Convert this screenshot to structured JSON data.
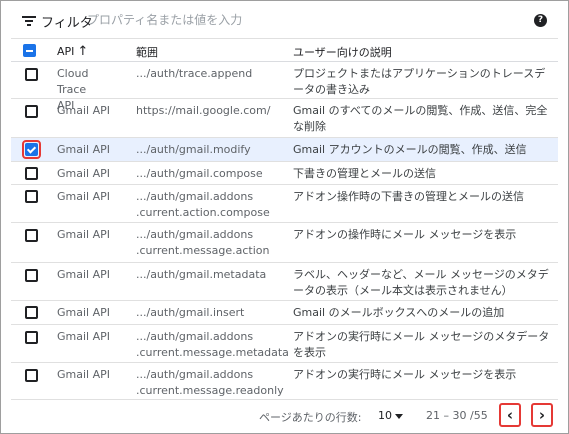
{
  "filter": {
    "label": "フィルタ",
    "placeholder": "プロパティ名または値を入力"
  },
  "help_icon": "?",
  "table": {
    "headers": {
      "api": "API",
      "scope": "範囲",
      "description": "ユーザー向けの説明"
    },
    "rows": [
      {
        "api": "Cloud Trace API",
        "scope": ".../auth/trace.append",
        "description": "プロジェクトまたはアプリケーションのトレースデータの書き込み",
        "checked": false
      },
      {
        "api": "Gmail API",
        "scope": "https://mail.google.com/",
        "description": "Gmail のすべてのメールの閲覧、作成、送信、完全な削除",
        "checked": false
      },
      {
        "api": "Gmail API",
        "scope": ".../auth/gmail.modify",
        "description": "Gmail アカウントのメールの閲覧、作成、送信",
        "checked": true
      },
      {
        "api": "Gmail API",
        "scope": ".../auth/gmail.compose",
        "description": "下書きの管理とメールの送信",
        "checked": false
      },
      {
        "api": "Gmail API",
        "scope": ".../auth/gmail.addons .current.action.compose",
        "description": "アドオン操作時の下書きの管理とメールの送信",
        "checked": false
      },
      {
        "api": "Gmail API",
        "scope": ".../auth/gmail.addons .current.message.action",
        "description": "アドオンの操作時にメール メッセージを表示",
        "checked": false
      },
      {
        "api": "Gmail API",
        "scope": ".../auth/gmail.metadata",
        "description": "ラベル、ヘッダーなど、メール メッセージのメタデータの表示（メール本文は表示されません）",
        "checked": false
      },
      {
        "api": "Gmail API",
        "scope": ".../auth/gmail.insert",
        "description": "Gmail のメールボックスへのメールの追加",
        "checked": false
      },
      {
        "api": "Gmail API",
        "scope": ".../auth/gmail.addons .current.message.metadata",
        "description": "アドオンの実行時にメール メッセージのメタデータを表示",
        "checked": false
      },
      {
        "api": "Gmail API",
        "scope": ".../auth/gmail.addons .current.message.readonly",
        "description": "アドオンの実行時にメール メッセージを表示",
        "checked": false
      }
    ]
  },
  "pagination": {
    "rows_per_page_label": "ページあたりの行数:",
    "rows_per_page_value": "10",
    "range": "21 – 30 /55",
    "prev": "‹",
    "next": "›"
  },
  "colors": {
    "accent": "#1a73e8",
    "highlight_ring": "#e53935",
    "selected_row": "#e8f0fe"
  }
}
